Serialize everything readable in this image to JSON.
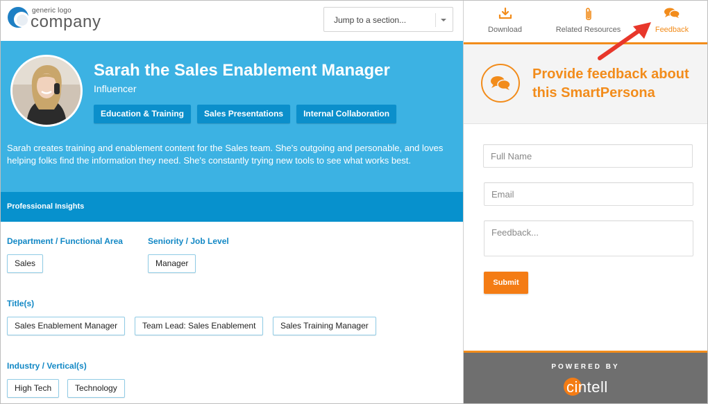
{
  "header": {
    "logo_small": "generic logo",
    "logo_big": "company",
    "jump_label": "Jump to a section..."
  },
  "persona": {
    "name": "Sarah the Sales Enablement Manager",
    "role": "Influencer",
    "tags": [
      "Education & Training",
      "Sales Presentations",
      "Internal Collaboration"
    ],
    "description": "Sarah creates training and enablement content for the Sales team. She's outgoing and personable, and loves helping folks find the information they need. She's constantly trying new tools to see what works best."
  },
  "insights": {
    "title": "Professional Insights",
    "department_label": "Department / Functional Area",
    "department_values": [
      "Sales"
    ],
    "seniority_label": "Seniority / Job Level",
    "seniority_values": [
      "Manager"
    ],
    "titles_label": "Title(s)",
    "titles_values": [
      "Sales Enablement Manager",
      "Team Lead: Sales Enablement",
      "Sales Training Manager"
    ],
    "industry_label": "Industry / Vertical(s)",
    "industry_values": [
      "High Tech",
      "Technology"
    ]
  },
  "tabs": [
    {
      "label": "Download",
      "icon": "download-icon"
    },
    {
      "label": "Related Resources",
      "icon": "paperclip-icon"
    },
    {
      "label": "Feedback",
      "icon": "chat-bubbles-icon"
    }
  ],
  "feedback": {
    "title": "Provide feedback about this SmartPersona",
    "name_placeholder": "Full Name",
    "email_placeholder": "Email",
    "feedback_placeholder": "Feedback...",
    "submit_label": "Submit"
  },
  "footer": {
    "powered": "POWERED BY",
    "brand_ci": "ci",
    "brand_rest": "ntell"
  },
  "colors": {
    "hero_blue": "#3cb2e3",
    "dark_blue": "#0791cd",
    "accent_orange": "#f28c1b",
    "arrow_red": "#e8372b"
  }
}
